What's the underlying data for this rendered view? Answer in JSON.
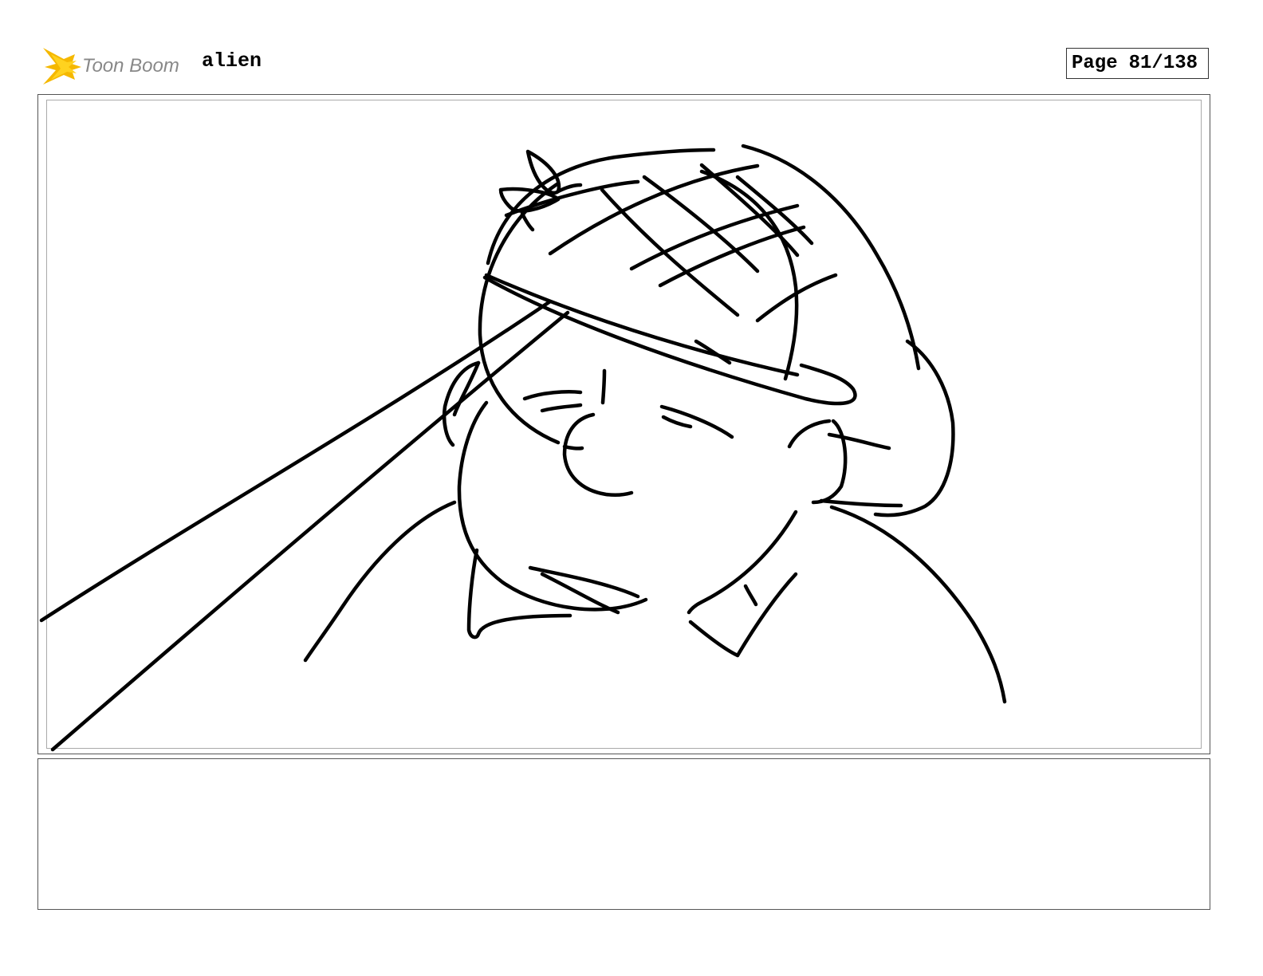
{
  "header": {
    "brand": "Toon Boom",
    "project_title": "alien",
    "page_label": "Page",
    "page_number": "81/138"
  },
  "colors": {
    "logo_star": "#f5b800",
    "logo_text": "#888888",
    "ink": "#000000"
  },
  "panel": {
    "sketch": "sketch-drawing"
  },
  "notes": {
    "text": ""
  }
}
